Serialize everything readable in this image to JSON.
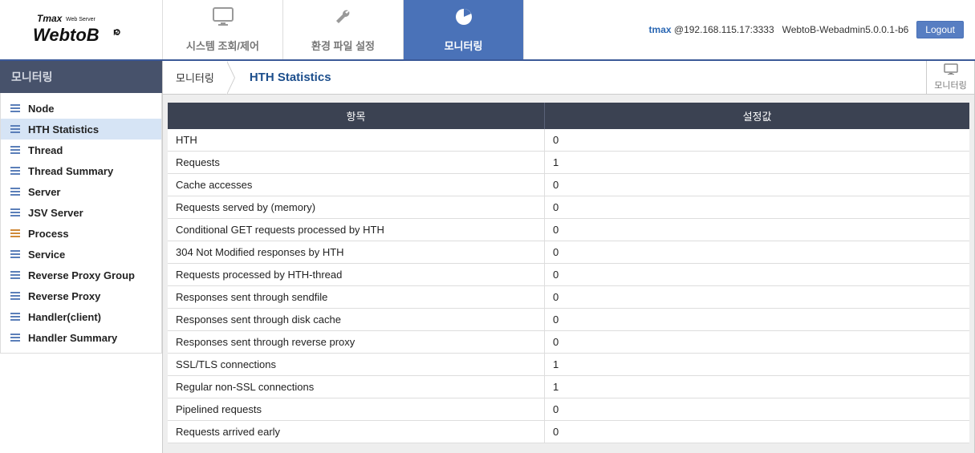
{
  "header": {
    "nav_tabs": [
      {
        "label": "시스템 조회/제어",
        "icon": "🖥"
      },
      {
        "label": "환경 파일 설정",
        "icon": "🔧"
      },
      {
        "label": "모니터링",
        "icon": "◔"
      }
    ],
    "user_name": "tmax",
    "user_host": "@192.168.115.17:3333",
    "version": "WebtoB-Webadmin5.0.0.1-b6",
    "logout_label": "Logout"
  },
  "sidebar": {
    "header": "모니터링",
    "items": [
      {
        "label": "Node",
        "icon_color": "#5b7fb9"
      },
      {
        "label": "HTH Statistics",
        "icon_color": "#5b7fb9"
      },
      {
        "label": "Thread",
        "icon_color": "#5b7fb9"
      },
      {
        "label": "Thread Summary",
        "icon_color": "#5b7fb9"
      },
      {
        "label": "Server",
        "icon_color": "#5b7fb9"
      },
      {
        "label": "JSV Server",
        "icon_color": "#5b7fb9"
      },
      {
        "label": "Process",
        "icon_color": "#d08a3a"
      },
      {
        "label": "Service",
        "icon_color": "#5b7fb9"
      },
      {
        "label": "Reverse Proxy Group",
        "icon_color": "#5b7fb9"
      },
      {
        "label": "Reverse Proxy",
        "icon_color": "#5b7fb9"
      },
      {
        "label": "Handler(client)",
        "icon_color": "#5b7fb9"
      },
      {
        "label": "Handler Summary",
        "icon_color": "#5b7fb9"
      }
    ]
  },
  "breadcrumb": {
    "root": "모니터링",
    "current": "HTH Statistics",
    "right_label": "모니터링"
  },
  "table": {
    "headers": {
      "item": "항목",
      "value": "설정값"
    },
    "rows": [
      {
        "item": "HTH",
        "value": "0"
      },
      {
        "item": "Requests",
        "value": "1"
      },
      {
        "item": "Cache accesses",
        "value": "0"
      },
      {
        "item": "Requests served by (memory)",
        "value": "0"
      },
      {
        "item": "Conditional GET requests processed by HTH",
        "value": "0"
      },
      {
        "item": "304 Not Modified responses by HTH",
        "value": "0"
      },
      {
        "item": "Requests processed by HTH-thread",
        "value": "0"
      },
      {
        "item": "Responses sent through sendfile",
        "value": "0"
      },
      {
        "item": "Responses sent through disk cache",
        "value": "0"
      },
      {
        "item": "Responses sent through reverse proxy",
        "value": "0"
      },
      {
        "item": "SSL/TLS connections",
        "value": "1"
      },
      {
        "item": "Regular non-SSL connections",
        "value": "1"
      },
      {
        "item": "Pipelined requests",
        "value": "0"
      },
      {
        "item": "Requests arrived early",
        "value": "0"
      }
    ]
  }
}
